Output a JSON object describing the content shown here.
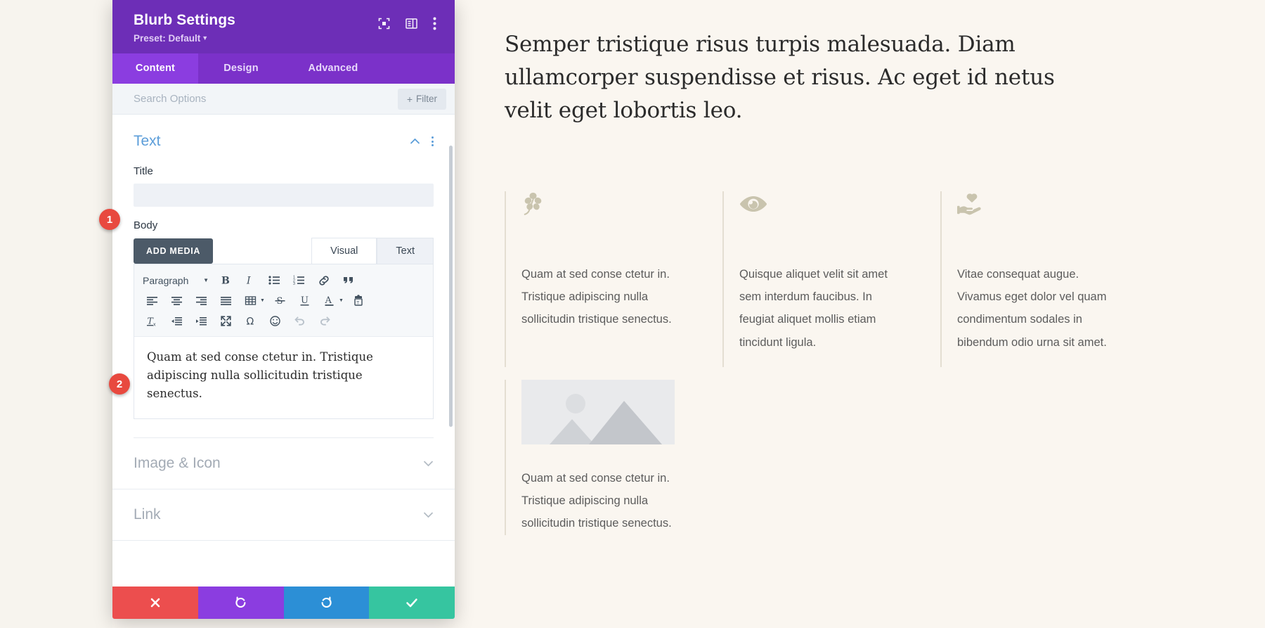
{
  "modal": {
    "title": "Blurb Settings",
    "preset_label": "Preset: Default",
    "header_icons": [
      {
        "name": "focus-icon"
      },
      {
        "name": "layout-panel-icon"
      },
      {
        "name": "more-vertical-icon"
      }
    ],
    "tabs": [
      {
        "label": "Content",
        "active": true
      },
      {
        "label": "Design",
        "active": false
      },
      {
        "label": "Advanced",
        "active": false
      }
    ],
    "search": {
      "placeholder": "Search Options",
      "value": ""
    },
    "filter_button": "Filter",
    "sections": [
      {
        "title": "Text",
        "state": "expanded"
      },
      {
        "title": "Image & Icon",
        "state": "collapsed"
      },
      {
        "title": "Link",
        "state": "collapsed"
      }
    ],
    "fields": {
      "title_label": "Title",
      "title_value": "",
      "body_label": "Body"
    },
    "editor": {
      "add_media": "ADD MEDIA",
      "mode_tabs": [
        {
          "label": "Visual",
          "active": true
        },
        {
          "label": "Text",
          "active": false
        }
      ],
      "format_select": "Paragraph",
      "toolbar_row1": [
        "bold-icon",
        "italic-icon",
        "bulleted-list-icon",
        "numbered-list-icon",
        "link-icon",
        "blockquote-icon"
      ],
      "toolbar_row2": [
        "align-left-icon",
        "align-center-icon",
        "align-right-icon",
        "align-justify-icon",
        "table-icon",
        "strikethrough-icon",
        "underline-icon",
        "text-color-icon",
        "paste-text-icon"
      ],
      "toolbar_row3": [
        "clear-formatting-icon",
        "outdent-icon",
        "indent-icon",
        "fullscreen-icon",
        "special-character-icon",
        "emoji-icon",
        "undo-icon",
        "redo-icon"
      ],
      "content": "Quam at sed conse ctetur in. Tristique adipiscing nulla sollicitudin tristique senectus."
    },
    "footer_buttons": [
      {
        "name": "discard-button",
        "icon": "close-icon",
        "color": "#ec4e4e"
      },
      {
        "name": "undo-button",
        "icon": "undo-icon",
        "color": "#8b3de0"
      },
      {
        "name": "redo-button",
        "icon": "redo-icon",
        "color": "#2c8fd6"
      },
      {
        "name": "save-button",
        "icon": "check-icon",
        "color": "#36c5a0"
      }
    ]
  },
  "badges": [
    {
      "label": "1"
    },
    {
      "label": "2"
    }
  ],
  "page": {
    "hero": "Semper tristique risus turpis malesuada. Diam ullamcorper suspendisse et risus. Ac eget id netus velit eget lobortis leo.",
    "blurbs": [
      {
        "icon": "leaf-icon",
        "body": "Quam at sed conse ctetur in. Tristique adipiscing nulla sollicitudin tristique senectus."
      },
      {
        "icon": "eye-icon",
        "body": "Quisque aliquet velit sit amet sem interdum faucibus. In feugiat aliquet mollis etiam tincidunt ligula."
      },
      {
        "icon": "hand-heart-icon",
        "body": "Vitae consequat augue. Vivamus eget dolor vel quam condimentum sodales in bibendum odio urna sit amet."
      }
    ],
    "image_blurb": {
      "icon": "image-placeholder-icon",
      "body": "Quam at sed conse ctetur in. Tristique adipiscing nulla sollicitudin tristique senectus."
    }
  },
  "colors": {
    "brand_purple": "#6d2eb7",
    "tab_purple": "#8b3de0",
    "accent_blue": "#5b9dd9",
    "page_bg": "#faf6f0",
    "icon_tan": "#c9c4ae"
  }
}
